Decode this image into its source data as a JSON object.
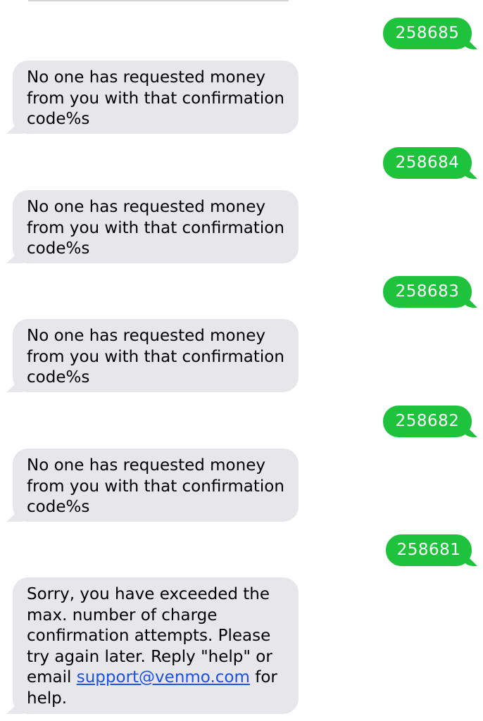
{
  "colors": {
    "sent_bubble": "#1ec23d",
    "received_bubble": "#e6e6eb",
    "link": "#1a51ea"
  },
  "messages": [
    {
      "direction": "sent",
      "text": "258685"
    },
    {
      "direction": "received",
      "text": "No one has requested money from you with that confirmation code%s"
    },
    {
      "direction": "sent",
      "text": "258684"
    },
    {
      "direction": "received",
      "text": "No one has requested money from you with that confirmation code%s"
    },
    {
      "direction": "sent",
      "text": "258683"
    },
    {
      "direction": "received",
      "text": "No one has requested money from you with that confirmation code%s"
    },
    {
      "direction": "sent",
      "text": "258682"
    },
    {
      "direction": "received",
      "text": "No one has requested money from you with that confirmation code%s"
    },
    {
      "direction": "sent",
      "text": "258681"
    },
    {
      "direction": "received",
      "text_before": "Sorry, you have exceeded the max. number of charge confirmation attempts. Please try again later. Reply \"help\" or email",
      "link": "support@venmo.com",
      "text_after": "for help."
    }
  ]
}
